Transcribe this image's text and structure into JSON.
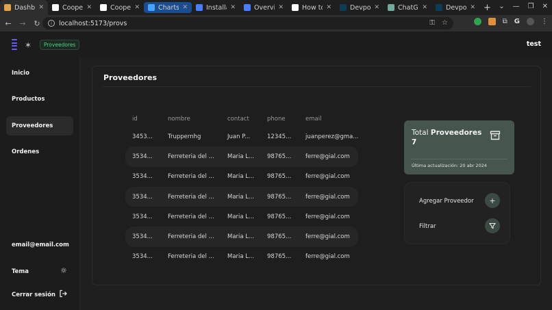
{
  "browser": {
    "tabs": [
      {
        "title": "Dashbo",
        "favicon": "app-favicon",
        "color": "#e0a44a"
      },
      {
        "title": "Cooper",
        "favicon": "github-icon",
        "color": "#ffffff"
      },
      {
        "title": "Cooper",
        "favicon": "github-icon",
        "color": "#ffffff"
      },
      {
        "title": "Charts -",
        "favicon": "charts-favicon",
        "color": "#4aa3ff"
      },
      {
        "title": "Installat",
        "favicon": "docs-favicon",
        "color": "#4a7cff"
      },
      {
        "title": "Overvie",
        "favicon": "docs-favicon",
        "color": "#4a7cff"
      },
      {
        "title": "How to",
        "favicon": "github-icon",
        "color": "#ffffff"
      },
      {
        "title": "Devpost",
        "favicon": "devpost-favicon",
        "color": "#0b3d57"
      },
      {
        "title": "ChatGP",
        "favicon": "chatgpt-favicon",
        "color": "#74aa9c"
      },
      {
        "title": "Devpost",
        "favicon": "devpost-favicon",
        "color": "#0b3d57"
      }
    ],
    "url": "localhost:5173/provs"
  },
  "app": {
    "breadcrumb": "Proveedores",
    "username": "test",
    "accent": "#6a5cff"
  },
  "sidebar": {
    "items": [
      {
        "label": "Inicio"
      },
      {
        "label": "Productos"
      },
      {
        "label": "Proveedores"
      },
      {
        "label": "Ordenes"
      }
    ],
    "email": "email@email.com",
    "theme_label": "Tema",
    "logout_label": "Cerrar sesión"
  },
  "main": {
    "title": "Proveedores",
    "table": {
      "headers": [
        "id",
        "nombre",
        "contact",
        "phone",
        "email"
      ],
      "rows": [
        [
          "3453...",
          "Truppernhg",
          "Juan P...",
          "12345...",
          "juanperez@gma..."
        ],
        [
          "3534...",
          "Ferreteria del ...",
          "Maria L...",
          "98765...",
          "ferre@gial.com"
        ],
        [
          "3534...",
          "Ferreteria del ...",
          "Maria L...",
          "98765...",
          "ferre@gial.com"
        ],
        [
          "3534...",
          "Ferreteria del ...",
          "Maria L...",
          "98765...",
          "ferre@gial.com"
        ],
        [
          "3534...",
          "Ferreteria del ...",
          "Maria L...",
          "98765...",
          "ferre@gial.com"
        ],
        [
          "3534...",
          "Ferreteria del ...",
          "Maria L...",
          "98765...",
          "ferre@gial.com"
        ],
        [
          "3534...",
          "Ferreteria del ...",
          "Maria L...",
          "98765...",
          "ferre@gial.com"
        ]
      ]
    },
    "summary": {
      "total_prefix": "Total",
      "total_bold": "Proveedores",
      "count": "7",
      "updated": "Última actualización: 20 abr 2024",
      "card_color": "#46554d"
    },
    "actions": {
      "add_label": "Agregar Proveedor",
      "filter_label": "Filtrar"
    }
  }
}
